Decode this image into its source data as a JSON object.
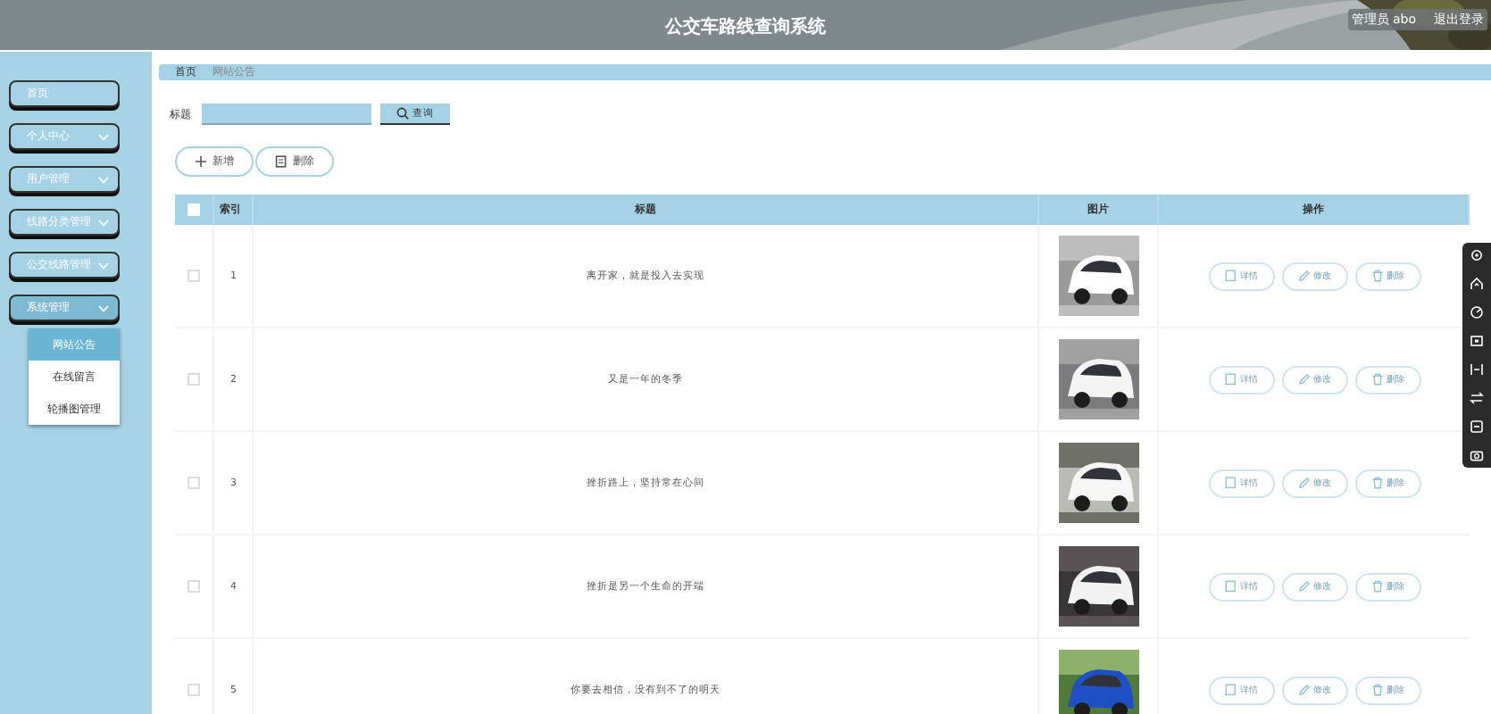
{
  "header": {
    "title": "公交车路线查询系统",
    "user": "管理员 abo",
    "logout": "退出登录"
  },
  "sidebar": {
    "items": [
      {
        "label": "首页",
        "expandable": false,
        "expanded": false
      },
      {
        "label": "个人中心",
        "expandable": true,
        "expanded": false
      },
      {
        "label": "用户管理",
        "expandable": true,
        "expanded": false
      },
      {
        "label": "线路分类管理",
        "expandable": true,
        "expanded": false
      },
      {
        "label": "公交线路管理",
        "expandable": true,
        "expanded": false
      },
      {
        "label": "系统管理",
        "expandable": true,
        "expanded": true,
        "children": [
          {
            "label": "网站公告",
            "selected": true
          },
          {
            "label": "在线留言",
            "selected": false
          },
          {
            "label": "轮播图管理",
            "selected": false
          }
        ]
      }
    ]
  },
  "breadcrumb": [
    "首页",
    "网站公告"
  ],
  "search": {
    "label": "标题",
    "button": "查询"
  },
  "actions": [
    {
      "kind": "add",
      "label": "新增"
    },
    {
      "kind": "delete",
      "label": "删除"
    }
  ],
  "table": {
    "select_all": false,
    "columns": [
      "索引",
      "标题",
      "图片",
      "操作"
    ],
    "rows": [
      {
        "checked": false,
        "index": "1",
        "title": "离开家，就是投入去实现",
        "picture": {
          "kind": "picture"
        },
        "actions": [
          "详情",
          "修改",
          "删除"
        ]
      },
      {
        "checked": false,
        "index": "2",
        "title": "又是一年的冬季",
        "picture": {
          "kind": "picture"
        },
        "actions": [
          "详情",
          "修改",
          "删除"
        ]
      },
      {
        "checked": false,
        "index": "3",
        "title": "挫折路上，坚持常在心间",
        "picture": {
          "kind": "picture"
        },
        "actions": [
          "详情",
          "修改",
          "删除"
        ]
      },
      {
        "checked": false,
        "index": "4",
        "title": "挫折是另一个生命的开端",
        "picture": {
          "kind": "picture"
        },
        "actions": [
          "详情",
          "修改",
          "删除"
        ]
      },
      {
        "checked": false,
        "index": "5",
        "title": "你要去相信，没有到不了的明天",
        "picture": {
          "kind": "picture"
        },
        "actions": [
          "详情",
          "修改",
          "删除"
        ]
      }
    ]
  }
}
